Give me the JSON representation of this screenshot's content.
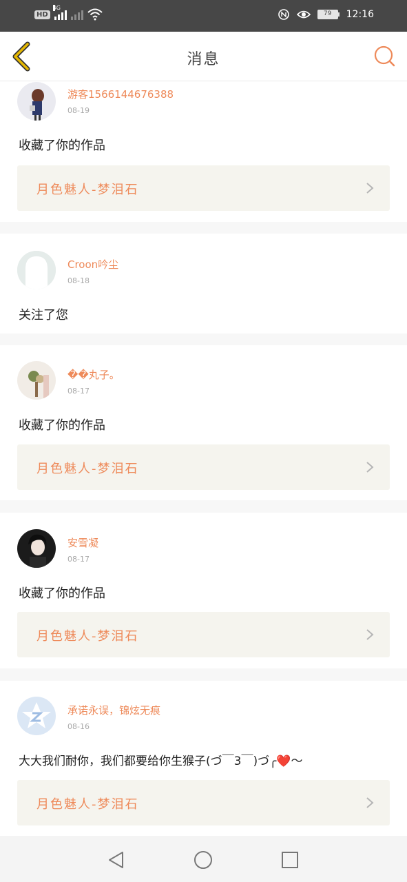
{
  "status_bar": {
    "hd": "HD",
    "network": "4G",
    "battery": "79",
    "time": "12:16"
  },
  "header": {
    "title": "消息",
    "icons": {
      "back": "chevron-left-icon",
      "search": "search-icon"
    }
  },
  "messages": [
    {
      "user": "游客1566144676388",
      "date": "08-19",
      "text": "收藏了你的作品",
      "work": "月色魅人-梦泪石"
    },
    {
      "user": "Croon吟尘",
      "date": "08-18",
      "text": "关注了您",
      "work": ""
    },
    {
      "user": "��丸子。",
      "date": "08-17",
      "text": "收藏了你的作品",
      "work": "月色魅人-梦泪石"
    },
    {
      "user": "安雪凝",
      "date": "08-17",
      "text": "收藏了你的作品",
      "work": "月色魅人-梦泪石"
    },
    {
      "user": "承诺永误，锦炫无痕",
      "date": "08-16",
      "text": "大大我们耐你，我们都要给你生猴子(づ￣3￣)づ╭❤️～",
      "work": "月色魅人-梦泪石"
    }
  ],
  "nav": {
    "back": "triangle-back-icon",
    "home": "circle-home-icon",
    "recents": "square-recents-icon"
  },
  "colors": {
    "accent": "#ee8a5a",
    "back_icon": "#e6b800",
    "work_box": "#f5f4ee"
  }
}
